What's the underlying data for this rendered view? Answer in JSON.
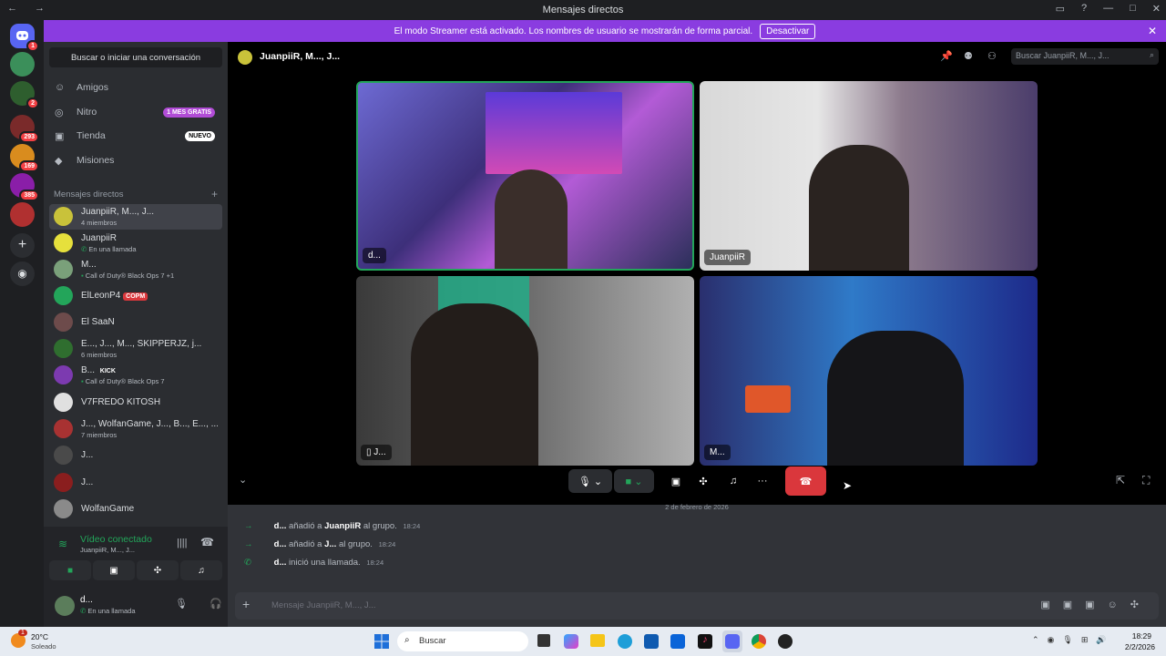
{
  "window": {
    "title": "Mensajes directos",
    "nav": "← →"
  },
  "banner": {
    "text": "El modo Streamer está activado. Los nombres de usuario se mostrarán de forma parcial.",
    "button": "Desactivar"
  },
  "servers": [
    {
      "badge": "1"
    },
    {
      "badge": ""
    },
    {
      "badge": "2"
    },
    {
      "badge": "293"
    },
    {
      "badge": "169"
    },
    {
      "badge": "385"
    },
    {
      "badge": ""
    }
  ],
  "sidebar": {
    "search": "Buscar o iniciar una conversación",
    "nav": [
      {
        "label": "Amigos",
        "tag": ""
      },
      {
        "label": "Nitro",
        "tag": "1 MES GRATIS"
      },
      {
        "label": "Tienda",
        "tag": "NUEVO"
      },
      {
        "label": "Misiones",
        "tag": ""
      }
    ],
    "dm_header": "Mensajes directos",
    "dms": [
      {
        "name": "JuanpiiR, M..., J...",
        "sub": "4 miembros"
      },
      {
        "name": "JuanpiiR",
        "sub": "En una llamada"
      },
      {
        "name": "M...",
        "sub": "Call of Duty® Black Ops 7 +1"
      },
      {
        "name": "ElLeonP4",
        "tag": "COPM",
        "sub": ""
      },
      {
        "name": "El SaaN",
        "sub": ""
      },
      {
        "name": "E..., J..., M..., SKIPPERJZ, j...",
        "sub": "6 miembros"
      },
      {
        "name": "B...",
        "tag": "KICK",
        "sub": "Call of Duty® Black Ops 7"
      },
      {
        "name": "V7FREDO KITOSH",
        "sub": ""
      },
      {
        "name": "J..., WolfanGame, J..., B..., E..., ...",
        "sub": "7 miembros"
      },
      {
        "name": "J...",
        "sub": ""
      },
      {
        "name": "J...",
        "sub": ""
      },
      {
        "name": "WolfanGame",
        "sub": ""
      }
    ],
    "voice": {
      "status": "Vídeo conectado",
      "channel": "JuanpiiR, M..., J..."
    },
    "user": {
      "name": "d...",
      "status": "En una llamada"
    }
  },
  "call": {
    "header": "JuanpiiR, M..., J...",
    "search_placeholder": "Buscar JuanpiiR, M..., J...",
    "tiles": [
      {
        "label": "d..."
      },
      {
        "label": "JuanpiiR"
      },
      {
        "label": "J..."
      },
      {
        "label": "M..."
      }
    ]
  },
  "chat": {
    "date_divider": "2 de febrero de 2026",
    "messages": [
      {
        "user": "d...",
        "text1": "añadió a",
        "target": "JuanpiiR",
        "text2": "al grupo.",
        "time": "18:24"
      },
      {
        "user": "d...",
        "text1": "añadió a",
        "target": "J...",
        "text2": "al grupo.",
        "time": "18:24"
      },
      {
        "user": "d...",
        "text1": "inició una llamada.",
        "target": "",
        "text2": "",
        "time": "18:24"
      }
    ],
    "composer_placeholder": "Mensaje JuanpiiR, M..., J..."
  },
  "taskbar": {
    "weather_temp": "20°C",
    "weather_desc": "Soleado",
    "weather_badge": "1",
    "search": "Buscar",
    "time": "18:29",
    "date": "2/2/2026"
  },
  "colors": {
    "accent": "#5865f2",
    "streamer": "#8a3ce0",
    "green": "#23a55a",
    "hangup": "#da373c"
  }
}
